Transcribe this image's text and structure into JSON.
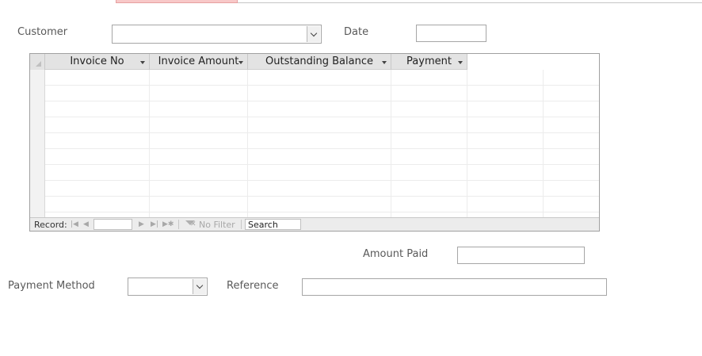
{
  "form": {
    "customer_label": "Customer",
    "customer_value": "",
    "date_label": "Date",
    "date_value": "",
    "amount_paid_label": "Amount Paid",
    "amount_paid_value": "",
    "payment_method_label": "Payment Method",
    "payment_method_value": "",
    "reference_label": "Reference",
    "reference_value": ""
  },
  "datasheet": {
    "columns": [
      {
        "label": "Invoice No"
      },
      {
        "label": "Invoice Amount"
      },
      {
        "label": "Outstanding Balance"
      },
      {
        "label": "Payment"
      }
    ],
    "rows": []
  },
  "nav": {
    "record_label": "Record:",
    "record_value": "",
    "no_filter_label": "No Filter",
    "search_value": "Search",
    "first_icon": "first-record-icon",
    "prev_icon": "prev-record-icon",
    "next_icon": "next-record-icon",
    "last_icon": "last-record-icon",
    "new_icon": "new-record-icon",
    "filter_icon": "filter-icon"
  }
}
